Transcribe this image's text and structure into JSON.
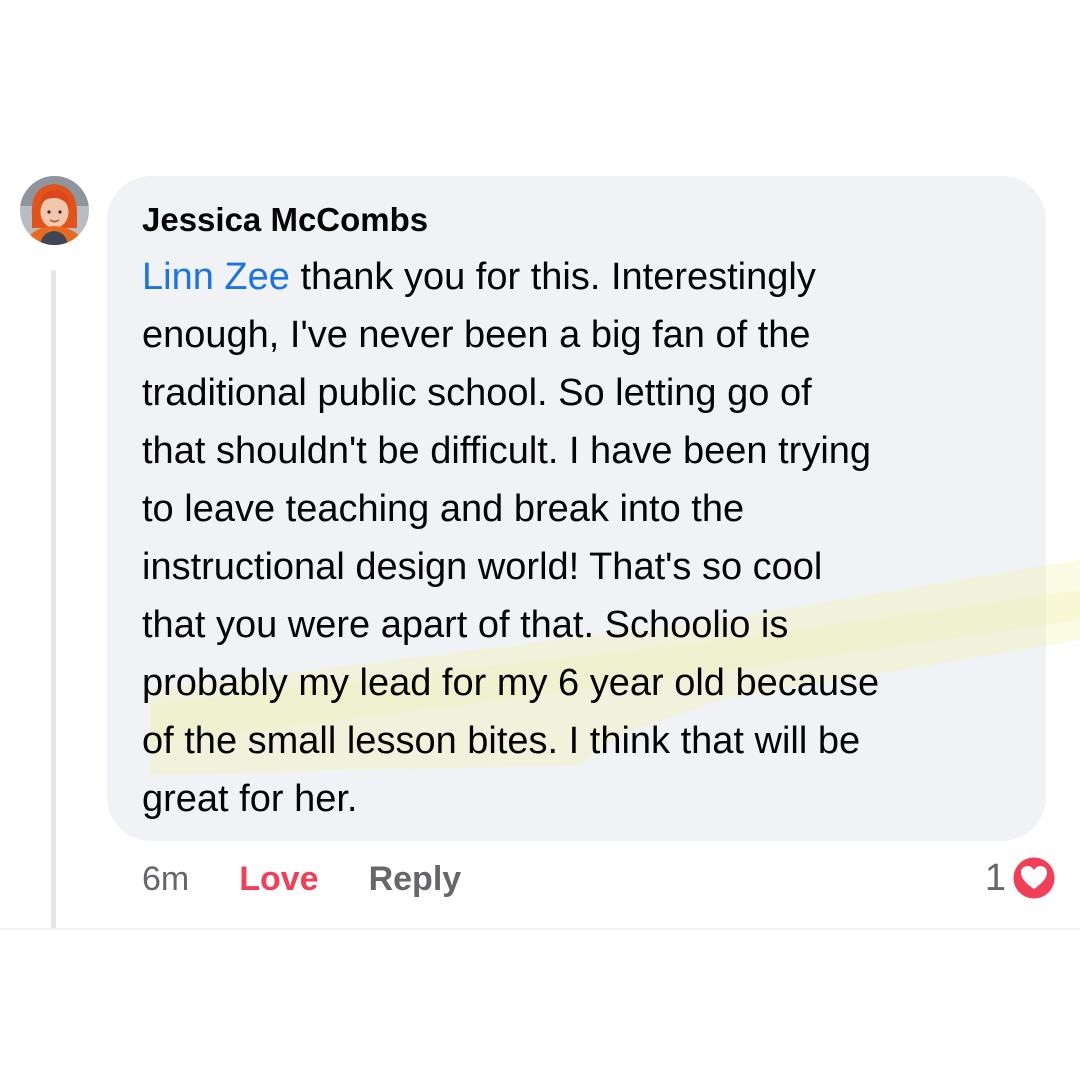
{
  "comment": {
    "author": "Jessica McCombs",
    "mention": "Linn Zee",
    "lines": [
      " thank you for this.  Interestingly",
      "enough, I've never been a big fan of the",
      "traditional public school. So letting go of",
      "that shouldn't be difficult. I have been trying",
      "to leave teaching and break into the",
      "instructional design world! That's so cool",
      "that you were apart of that. Schoolio is",
      "probably my lead for my 6 year old because",
      "of the small lesson bites. I think that will be",
      "great for her."
    ],
    "timestamp": "6m",
    "love_label": "Love",
    "reply_label": "Reply",
    "reaction_count": "1",
    "reaction_icon": "love-heart-icon"
  },
  "colors": {
    "bubble": "#f0f2f5",
    "mention": "#1b74e4",
    "love": "#f33e58",
    "muted": "#65676b",
    "highlight": "#f4f5c8"
  }
}
